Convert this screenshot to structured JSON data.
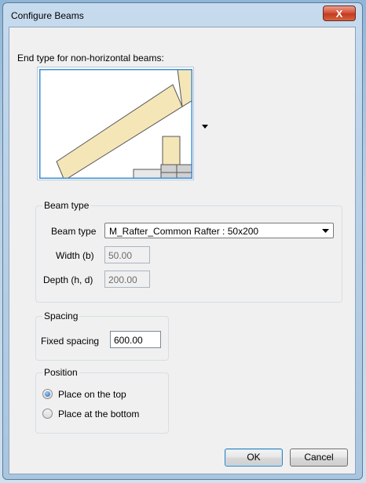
{
  "window": {
    "title": "Configure Beams",
    "close_glyph": "X"
  },
  "end_type": {
    "label": "End type for non-horizontal beams:"
  },
  "beam_type": {
    "group_title": "Beam type",
    "type_label": "Beam type",
    "type_value": "M_Rafter_Common Rafter : 50x200",
    "width_label": "Width (b)",
    "width_value": "50.00",
    "depth_label": "Depth (h, d)",
    "depth_value": "200.00"
  },
  "spacing": {
    "group_title": "Spacing",
    "fixed_label": "Fixed spacing",
    "fixed_value": "600.00"
  },
  "position": {
    "group_title": "Position",
    "options": [
      {
        "label": "Place on the top",
        "checked": true
      },
      {
        "label": "Place at the bottom",
        "checked": false
      }
    ]
  },
  "buttons": {
    "ok": "OK",
    "cancel": "Cancel"
  },
  "colors": {
    "beam_fill": "#f5e6b8",
    "accent": "#3c8fd8"
  }
}
